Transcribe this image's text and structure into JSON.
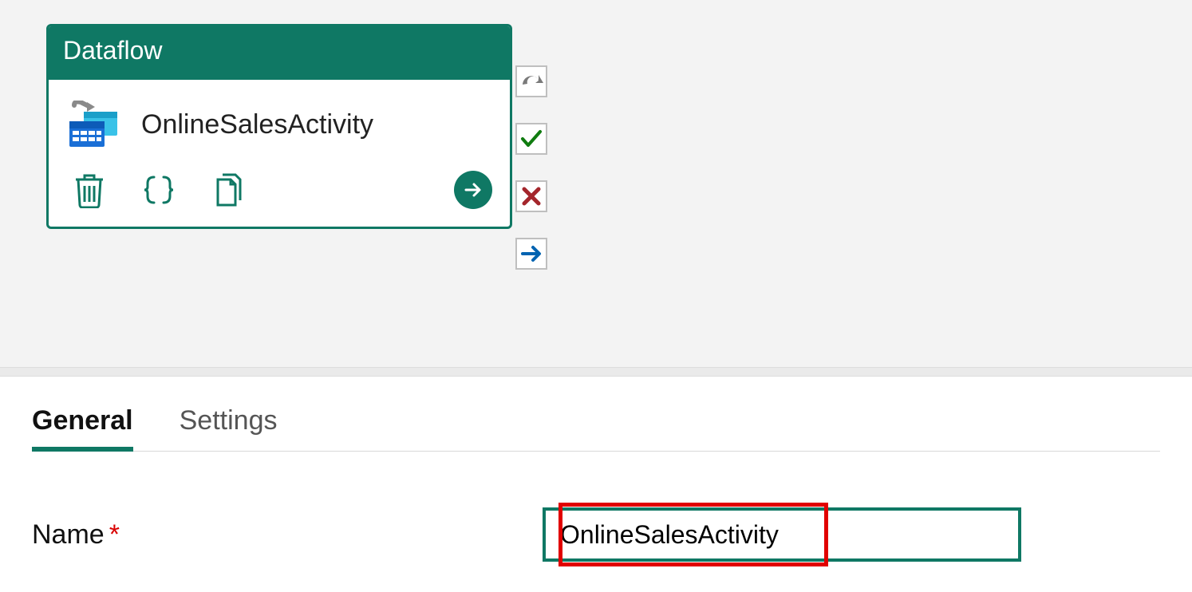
{
  "activity": {
    "type_label": "Dataflow",
    "name": "OnlineSalesActivity"
  },
  "tabs": {
    "general": "General",
    "settings": "Settings"
  },
  "form": {
    "name_label": "Name",
    "name_value": "OnlineSalesActivity"
  }
}
